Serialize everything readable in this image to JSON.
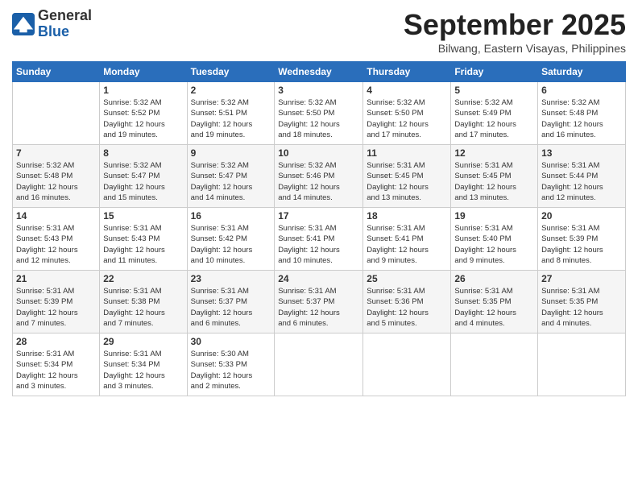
{
  "header": {
    "logo_line1": "General",
    "logo_line2": "Blue",
    "month_title": "September 2025",
    "location": "Bilwang, Eastern Visayas, Philippines"
  },
  "days_of_week": [
    "Sunday",
    "Monday",
    "Tuesday",
    "Wednesday",
    "Thursday",
    "Friday",
    "Saturday"
  ],
  "weeks": [
    [
      {
        "day": "",
        "info": ""
      },
      {
        "day": "1",
        "info": "Sunrise: 5:32 AM\nSunset: 5:52 PM\nDaylight: 12 hours\nand 19 minutes."
      },
      {
        "day": "2",
        "info": "Sunrise: 5:32 AM\nSunset: 5:51 PM\nDaylight: 12 hours\nand 19 minutes."
      },
      {
        "day": "3",
        "info": "Sunrise: 5:32 AM\nSunset: 5:50 PM\nDaylight: 12 hours\nand 18 minutes."
      },
      {
        "day": "4",
        "info": "Sunrise: 5:32 AM\nSunset: 5:50 PM\nDaylight: 12 hours\nand 17 minutes."
      },
      {
        "day": "5",
        "info": "Sunrise: 5:32 AM\nSunset: 5:49 PM\nDaylight: 12 hours\nand 17 minutes."
      },
      {
        "day": "6",
        "info": "Sunrise: 5:32 AM\nSunset: 5:48 PM\nDaylight: 12 hours\nand 16 minutes."
      }
    ],
    [
      {
        "day": "7",
        "info": "Sunrise: 5:32 AM\nSunset: 5:48 PM\nDaylight: 12 hours\nand 16 minutes."
      },
      {
        "day": "8",
        "info": "Sunrise: 5:32 AM\nSunset: 5:47 PM\nDaylight: 12 hours\nand 15 minutes."
      },
      {
        "day": "9",
        "info": "Sunrise: 5:32 AM\nSunset: 5:47 PM\nDaylight: 12 hours\nand 14 minutes."
      },
      {
        "day": "10",
        "info": "Sunrise: 5:32 AM\nSunset: 5:46 PM\nDaylight: 12 hours\nand 14 minutes."
      },
      {
        "day": "11",
        "info": "Sunrise: 5:31 AM\nSunset: 5:45 PM\nDaylight: 12 hours\nand 13 minutes."
      },
      {
        "day": "12",
        "info": "Sunrise: 5:31 AM\nSunset: 5:45 PM\nDaylight: 12 hours\nand 13 minutes."
      },
      {
        "day": "13",
        "info": "Sunrise: 5:31 AM\nSunset: 5:44 PM\nDaylight: 12 hours\nand 12 minutes."
      }
    ],
    [
      {
        "day": "14",
        "info": "Sunrise: 5:31 AM\nSunset: 5:43 PM\nDaylight: 12 hours\nand 12 minutes."
      },
      {
        "day": "15",
        "info": "Sunrise: 5:31 AM\nSunset: 5:43 PM\nDaylight: 12 hours\nand 11 minutes."
      },
      {
        "day": "16",
        "info": "Sunrise: 5:31 AM\nSunset: 5:42 PM\nDaylight: 12 hours\nand 10 minutes."
      },
      {
        "day": "17",
        "info": "Sunrise: 5:31 AM\nSunset: 5:41 PM\nDaylight: 12 hours\nand 10 minutes."
      },
      {
        "day": "18",
        "info": "Sunrise: 5:31 AM\nSunset: 5:41 PM\nDaylight: 12 hours\nand 9 minutes."
      },
      {
        "day": "19",
        "info": "Sunrise: 5:31 AM\nSunset: 5:40 PM\nDaylight: 12 hours\nand 9 minutes."
      },
      {
        "day": "20",
        "info": "Sunrise: 5:31 AM\nSunset: 5:39 PM\nDaylight: 12 hours\nand 8 minutes."
      }
    ],
    [
      {
        "day": "21",
        "info": "Sunrise: 5:31 AM\nSunset: 5:39 PM\nDaylight: 12 hours\nand 7 minutes."
      },
      {
        "day": "22",
        "info": "Sunrise: 5:31 AM\nSunset: 5:38 PM\nDaylight: 12 hours\nand 7 minutes."
      },
      {
        "day": "23",
        "info": "Sunrise: 5:31 AM\nSunset: 5:37 PM\nDaylight: 12 hours\nand 6 minutes."
      },
      {
        "day": "24",
        "info": "Sunrise: 5:31 AM\nSunset: 5:37 PM\nDaylight: 12 hours\nand 6 minutes."
      },
      {
        "day": "25",
        "info": "Sunrise: 5:31 AM\nSunset: 5:36 PM\nDaylight: 12 hours\nand 5 minutes."
      },
      {
        "day": "26",
        "info": "Sunrise: 5:31 AM\nSunset: 5:35 PM\nDaylight: 12 hours\nand 4 minutes."
      },
      {
        "day": "27",
        "info": "Sunrise: 5:31 AM\nSunset: 5:35 PM\nDaylight: 12 hours\nand 4 minutes."
      }
    ],
    [
      {
        "day": "28",
        "info": "Sunrise: 5:31 AM\nSunset: 5:34 PM\nDaylight: 12 hours\nand 3 minutes."
      },
      {
        "day": "29",
        "info": "Sunrise: 5:31 AM\nSunset: 5:34 PM\nDaylight: 12 hours\nand 3 minutes."
      },
      {
        "day": "30",
        "info": "Sunrise: 5:30 AM\nSunset: 5:33 PM\nDaylight: 12 hours\nand 2 minutes."
      },
      {
        "day": "",
        "info": ""
      },
      {
        "day": "",
        "info": ""
      },
      {
        "day": "",
        "info": ""
      },
      {
        "day": "",
        "info": ""
      }
    ]
  ]
}
